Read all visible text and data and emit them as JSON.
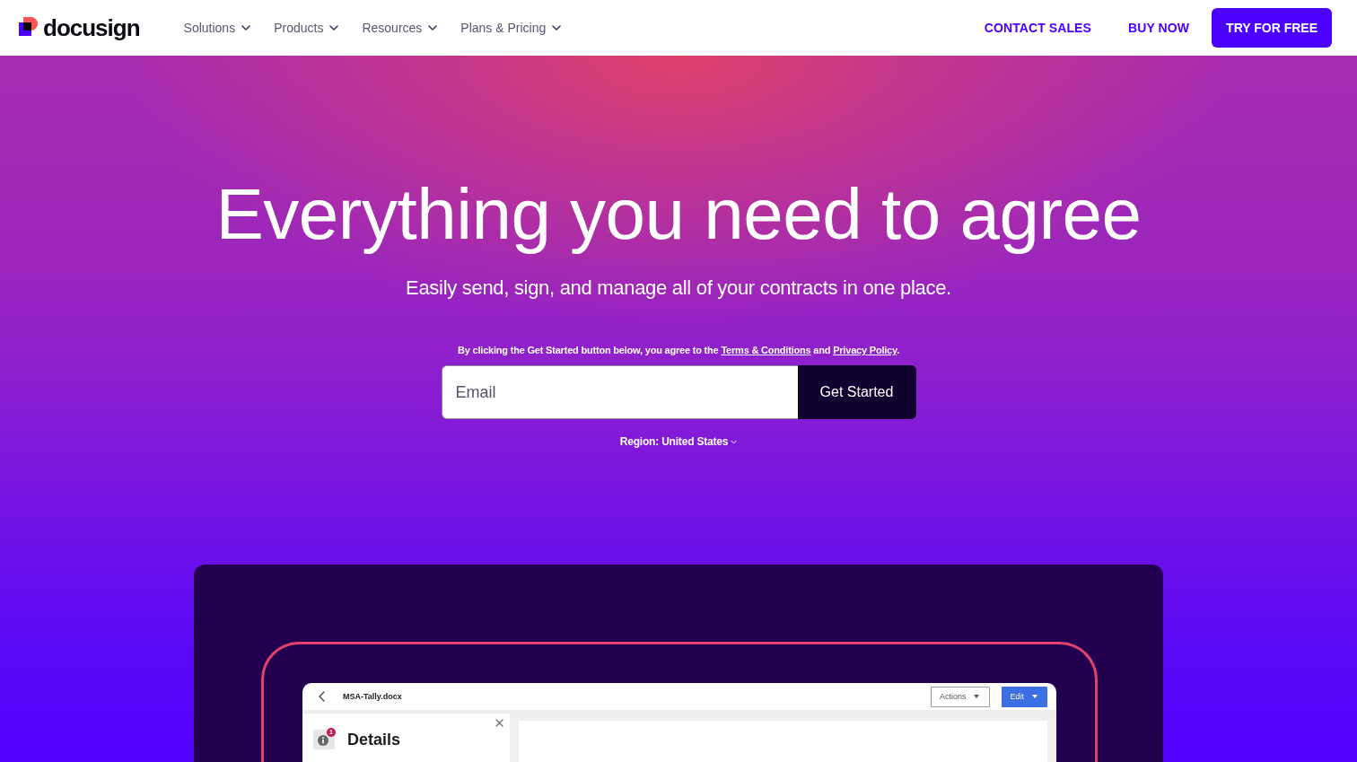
{
  "header": {
    "logo": {
      "text": "docusign"
    },
    "nav": [
      {
        "label": "Solutions"
      },
      {
        "label": "Products"
      },
      {
        "label": "Resources"
      },
      {
        "label": "Plans & Pricing"
      }
    ],
    "actions": [
      {
        "label": "CONTACT SALES",
        "kind": "link"
      },
      {
        "label": "BUY NOW",
        "kind": "link"
      },
      {
        "label": "TRY FOR FREE",
        "kind": "button"
      }
    ]
  },
  "hero": {
    "title": "Everything you need to agree",
    "subtitle": "Easily send, sign, and manage all of your contracts in one place.",
    "consent": [
      {
        "kind": "text",
        "text": "By clicking the Get Started button below, you agree to the "
      },
      {
        "kind": "link",
        "text": "Terms & Conditions"
      },
      {
        "kind": "text",
        "text": " and "
      },
      {
        "kind": "link",
        "text": "Privacy Policy"
      },
      {
        "kind": "text",
        "text": "."
      }
    ],
    "signup": {
      "email": {
        "placeholder": "Email"
      },
      "button": "Get Started"
    },
    "region": "Region: United States"
  },
  "preview": {
    "app": {
      "filename": "MSA-Tally.docx",
      "buttons": [
        {
          "label": "Actions",
          "kind": "dropdown"
        },
        {
          "label": "Edit",
          "kind": "primary"
        }
      ],
      "panel": {
        "title": "Details",
        "badge": "1"
      }
    }
  }
}
